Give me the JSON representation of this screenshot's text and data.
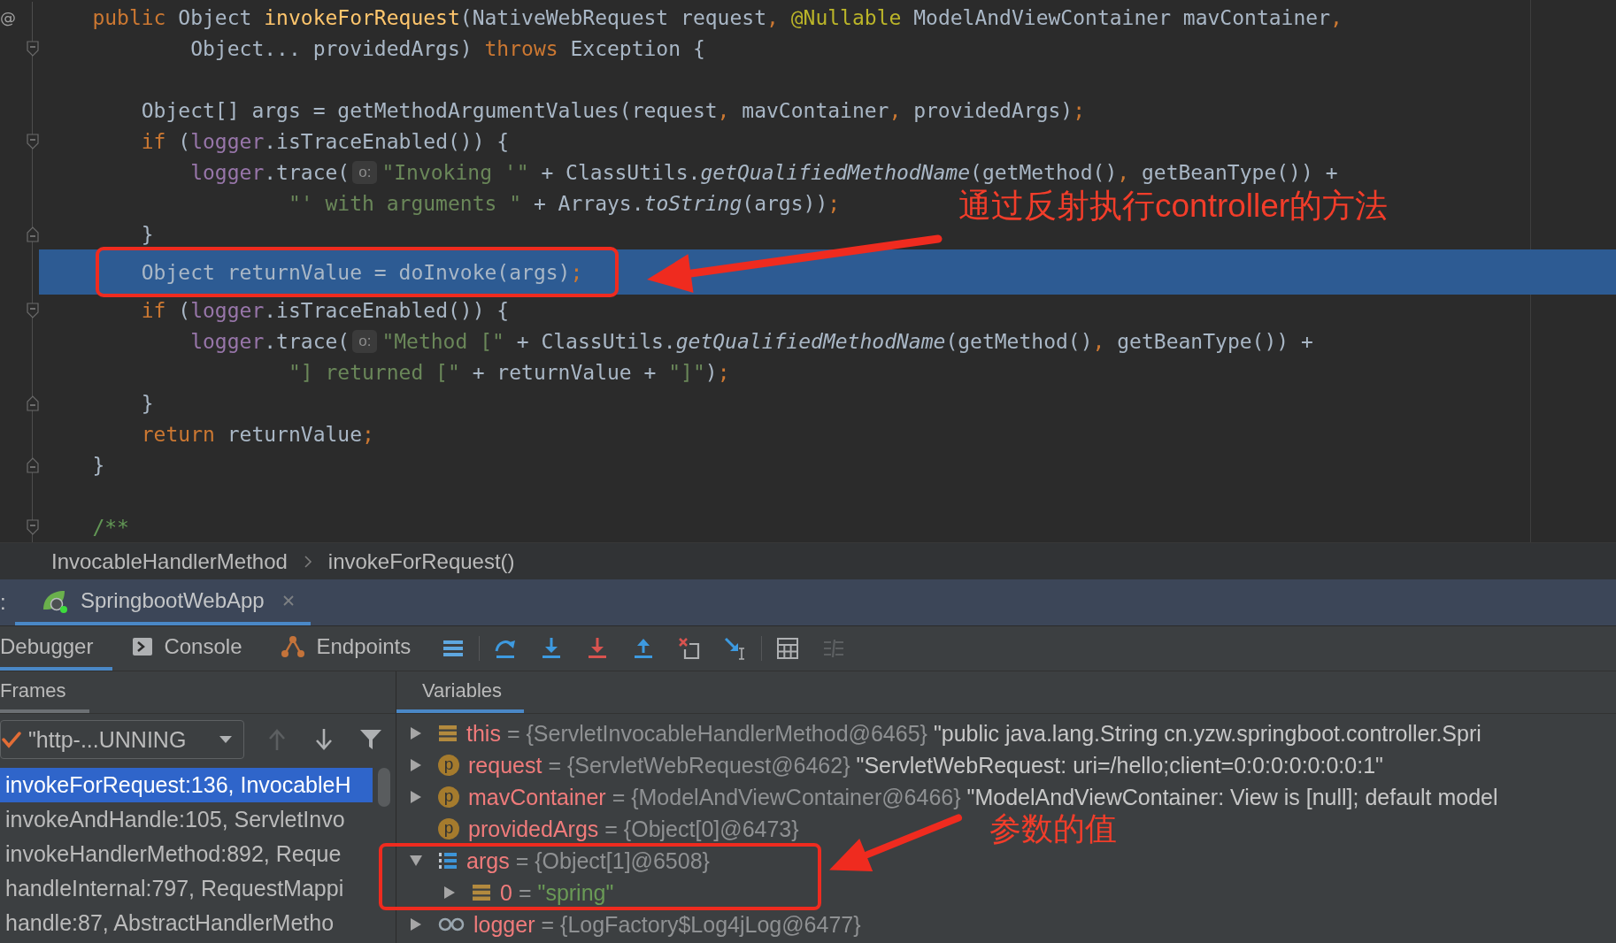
{
  "editor": {
    "lines": [
      {
        "kind": "plain",
        "gutter": "@",
        "current": false,
        "tokens": [
          {
            "kind": "keyword",
            "text": "    public"
          },
          {
            "kind": "plain",
            "text": " Object "
          },
          {
            "kind": "declaration",
            "text": "invokeForRequest"
          },
          {
            "kind": "plain",
            "text": "(NativeWebRequest request"
          },
          {
            "kind": "punct",
            "text": ","
          },
          {
            "kind": "annotation",
            "text": " @Nullable"
          },
          {
            "kind": "plain",
            "text": " ModelAndViewContainer mavContainer"
          },
          {
            "kind": "punct",
            "text": ","
          }
        ]
      },
      {
        "kind": "fold-start",
        "current": false,
        "tokens": [
          {
            "kind": "plain",
            "text": "            Object... providedArgs) "
          },
          {
            "kind": "keyword",
            "text": "throws"
          },
          {
            "kind": "plain",
            "text": " Exception {"
          }
        ]
      },
      {
        "kind": "plain",
        "current": false
      },
      {
        "kind": "plain",
        "current": false,
        "tokens": [
          {
            "kind": "plain",
            "text": "        Object[] args = getMethodArgumentValues(request"
          },
          {
            "kind": "punct",
            "text": ","
          },
          {
            "kind": "plain",
            "text": " mavContainer"
          },
          {
            "kind": "punct",
            "text": ","
          },
          {
            "kind": "plain",
            "text": " providedArgs)"
          },
          {
            "kind": "punct",
            "text": ";"
          }
        ]
      },
      {
        "kind": "fold-start",
        "current": false,
        "tokens": [
          {
            "kind": "keyword",
            "text": "        if"
          },
          {
            "kind": "plain",
            "text": " ("
          },
          {
            "kind": "field",
            "text": "logger"
          },
          {
            "kind": "plain",
            "text": ".isTraceEnabled()) {"
          }
        ]
      },
      {
        "kind": "plain",
        "current": false,
        "tokens": [
          {
            "kind": "field",
            "text": "            logger"
          },
          {
            "kind": "plain",
            "text": ".trace("
          },
          {
            "kind": "hint",
            "text": "o:"
          },
          {
            "kind": "string",
            "text": "\"Invoking '\""
          },
          {
            "kind": "plain",
            "text": " + ClassUtils."
          },
          {
            "kind": "static",
            "text": "getQualifiedMethodName"
          },
          {
            "kind": "plain",
            "text": "(getMethod()"
          },
          {
            "kind": "punct",
            "text": ","
          },
          {
            "kind": "plain",
            "text": " getBeanType()) +"
          }
        ]
      },
      {
        "kind": "plain",
        "current": false,
        "tokens": [
          {
            "kind": "string",
            "text": "                    \"' with arguments \""
          },
          {
            "kind": "plain",
            "text": " + Arrays."
          },
          {
            "kind": "static",
            "text": "toString"
          },
          {
            "kind": "plain",
            "text": "(args))"
          },
          {
            "kind": "punct",
            "text": ";"
          }
        ]
      },
      {
        "kind": "fold-end",
        "current": false,
        "tokens": [
          {
            "kind": "plain",
            "text": "        }"
          }
        ]
      },
      {
        "kind": "plain",
        "current": true,
        "callout": "通过反射执行controller的方法",
        "tokens": [
          {
            "kind": "plain",
            "text": "        Object returnValue = doInvoke(args)"
          },
          {
            "kind": "punct",
            "text": ";"
          }
        ]
      },
      {
        "kind": "fold-start",
        "current": false,
        "tokens": [
          {
            "kind": "keyword",
            "text": "        if"
          },
          {
            "kind": "plain",
            "text": " ("
          },
          {
            "kind": "field",
            "text": "logger"
          },
          {
            "kind": "plain",
            "text": ".isTraceEnabled()) {"
          }
        ]
      },
      {
        "kind": "plain",
        "current": false,
        "tokens": [
          {
            "kind": "field",
            "text": "            logger"
          },
          {
            "kind": "plain",
            "text": ".trace("
          },
          {
            "kind": "hint",
            "text": "o:"
          },
          {
            "kind": "string",
            "text": "\"Method [\""
          },
          {
            "kind": "plain",
            "text": " + ClassUtils."
          },
          {
            "kind": "static",
            "text": "getQualifiedMethodName"
          },
          {
            "kind": "plain",
            "text": "(getMethod()"
          },
          {
            "kind": "punct",
            "text": ","
          },
          {
            "kind": "plain",
            "text": " getBeanType()) +"
          }
        ]
      },
      {
        "kind": "plain",
        "current": false,
        "tokens": [
          {
            "kind": "string",
            "text": "                    \"] returned [\""
          },
          {
            "kind": "plain",
            "text": " + returnValue + "
          },
          {
            "kind": "string",
            "text": "\"]\""
          },
          {
            "kind": "plain",
            "text": ")"
          },
          {
            "kind": "punct",
            "text": ";"
          }
        ]
      },
      {
        "kind": "fold-end",
        "current": false,
        "tokens": [
          {
            "kind": "plain",
            "text": "        }"
          }
        ]
      },
      {
        "kind": "plain",
        "current": false,
        "tokens": [
          {
            "kind": "keyword",
            "text": "        return"
          },
          {
            "kind": "plain",
            "text": " returnValue"
          },
          {
            "kind": "punct",
            "text": ";"
          }
        ]
      },
      {
        "kind": "fold-end",
        "current": false,
        "tokens": [
          {
            "kind": "plain",
            "text": "    }"
          }
        ]
      },
      {
        "kind": "plain",
        "current": false
      },
      {
        "kind": "fold-start",
        "current": false,
        "tokens": [
          {
            "kind": "comment",
            "text": "    /**"
          }
        ]
      }
    ]
  },
  "breadcrumbs": [
    {
      "label": "InvocableHandlerMethod"
    },
    {
      "label": "invokeForRequest()"
    }
  ],
  "debug_window": {
    "title": ":",
    "sessions": [
      {
        "label": "SpringbootWebApp",
        "selected": true
      }
    ]
  },
  "toolbar": {
    "tabs": [
      {
        "kind": "debugger",
        "label": "Debugger",
        "selected": true
      },
      {
        "kind": "console",
        "label": "Console",
        "selected": false
      },
      {
        "kind": "endpoints",
        "label": "Endpoints",
        "selected": false
      }
    ],
    "buttons": [
      {
        "kind": "frames-menu",
        "disabled": false
      },
      {
        "kind": "separator"
      },
      {
        "kind": "step-over",
        "disabled": false
      },
      {
        "kind": "step-into",
        "disabled": false
      },
      {
        "kind": "force-step-into",
        "disabled": false
      },
      {
        "kind": "step-out",
        "disabled": false
      },
      {
        "kind": "drop-frame",
        "disabled": false
      },
      {
        "kind": "run-to-cursor",
        "disabled": false
      },
      {
        "kind": "separator"
      },
      {
        "kind": "evaluate",
        "disabled": false
      },
      {
        "kind": "trace",
        "disabled": true
      }
    ]
  },
  "frames": {
    "title": "Frames",
    "focused": false,
    "thread": "\"http-...UNNING",
    "nav": [
      {
        "kind": "up",
        "disabled": true
      },
      {
        "kind": "down",
        "disabled": false
      },
      {
        "kind": "filter",
        "disabled": false
      }
    ],
    "items": [
      {
        "label": "invokeForRequest:136, InvocableH",
        "selected": true
      },
      {
        "label": "invokeAndHandle:105, ServletInvo",
        "selected": false
      },
      {
        "label": "invokeHandlerMethod:892, Reque",
        "selected": false
      },
      {
        "label": "handleInternal:797, RequestMappi",
        "selected": false
      },
      {
        "label": "handle:87, AbstractHandlerMetho",
        "selected": false
      }
    ]
  },
  "variables": {
    "title": "Variables",
    "focused": true,
    "rows": [
      {
        "kind": "field",
        "name": "this",
        "summary": "= {ServletInvocableHandlerMethod@6465}",
        "value": "\"public java.lang.String cn.yzw.springboot.controller.Spri",
        "literal": false,
        "expanded": false
      },
      {
        "kind": "parameter",
        "badge": "p",
        "name": "request",
        "summary": "= {ServletWebRequest@6462}",
        "value": "\"ServletWebRequest: uri=/hello;client=0:0:0:0:0:0:0:1\"",
        "literal": false,
        "expanded": false
      },
      {
        "kind": "parameter",
        "badge": "p",
        "name": "mavContainer",
        "summary": "= {ModelAndViewContainer@6466}",
        "value": "\"ModelAndViewContainer: View is [null]; default model",
        "literal": false,
        "expanded": false
      },
      {
        "kind": "parameter",
        "badge": "p",
        "name": "providedArgs",
        "summary": "= {Object[0]@6473}"
      },
      {
        "kind": "array",
        "name": "args",
        "summary": "= {Object[1]@6508}",
        "expanded": true,
        "callout": "参数的值",
        "children": [
          {
            "kind": "field",
            "name": "0",
            "summary": "=",
            "value": "\"spring\"",
            "literal": true,
            "expanded": false
          }
        ]
      },
      {
        "kind": "static",
        "name": "logger",
        "summary": "= {LogFactory$Log4jLog@6477}",
        "expanded": false
      }
    ]
  }
}
